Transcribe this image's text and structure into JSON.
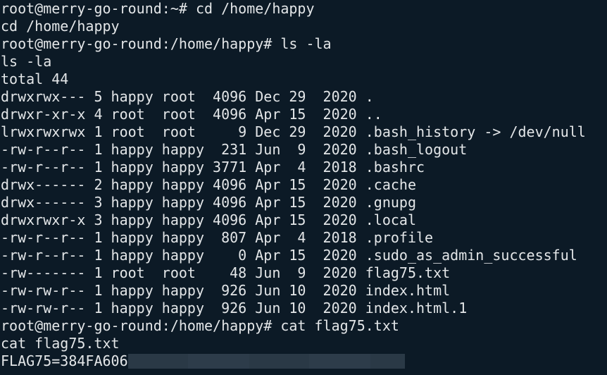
{
  "terminal": {
    "background": "#0c1a26",
    "foreground": "#e3e6e8",
    "lines": [
      "root@merry-go-round:~# cd /home/happy",
      "cd /home/happy",
      "root@merry-go-round:/home/happy# ls -la",
      "ls -la",
      "total 44",
      "drwxrwx--- 5 happy root  4096 Dec 29  2020 .",
      "drwxr-xr-x 4 root  root  4096 Apr 15  2020 ..",
      "lrwxrwxrwx 1 root  root     9 Dec 29  2020 .bash_history -> /dev/null",
      "-rw-r--r-- 1 happy happy  231 Jun  9  2020 .bash_logout",
      "-rw-r--r-- 1 happy happy 3771 Apr  4  2018 .bashrc",
      "drwx------ 2 happy happy 4096 Apr 15  2020 .cache",
      "drwx------ 3 happy happy 4096 Apr 15  2020 .gnupg",
      "drwxrwxr-x 3 happy happy 4096 Apr 15  2020 .local",
      "-rw-r--r-- 1 happy happy  807 Apr  4  2018 .profile",
      "-rw-r--r-- 1 happy happy    0 Apr 15  2020 .sudo_as_admin_successful",
      "-rw------- 1 root  root    48 Jun  9  2020 flag75.txt",
      "-rw-rw-r-- 1 happy happy  926 Jun 10  2020 index.html",
      "-rw-rw-r-- 1 happy happy  926 Jun 10  2020 index.html.1",
      "root@merry-go-round:/home/happy# cat flag75.txt",
      "cat flag75.txt"
    ],
    "flag_line_prefix": "FLAG75=384FA606"
  }
}
